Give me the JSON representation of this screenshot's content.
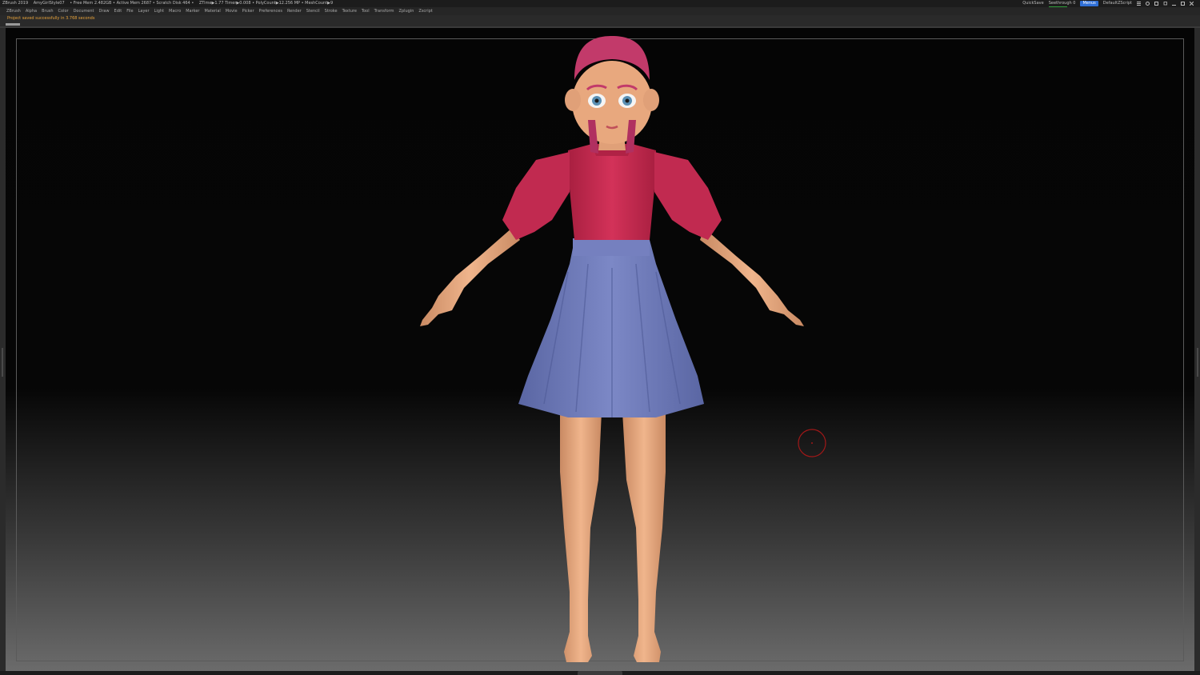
{
  "titlebar": {
    "items": [
      "ZBrush 2019",
      "AmyGirlStyle07",
      "• Free Mem 2.482GB • Active Mem 2687 • Scratch Disk 464 •",
      "ZTime▶1.77 Timer▶0.008 • PolyCount▶12.256 MP • MeshCount▶9"
    ],
    "right": {
      "quicksave": "QuickSave",
      "see_through": "Seethrough 0",
      "menus": "Menus",
      "script": "DefaultZScript"
    },
    "window_icons": [
      "list-icon",
      "gear-icon",
      "layout-icon",
      "restore-icon",
      "minimize-icon",
      "maximize-icon",
      "close-icon"
    ]
  },
  "menubar": {
    "items": [
      "ZBrush",
      "Alpha",
      "Brush",
      "Color",
      "Document",
      "Draw",
      "Edit",
      "File",
      "Layer",
      "Light",
      "Macro",
      "Marker",
      "Material",
      "Movie",
      "Picker",
      "Preferences",
      "Render",
      "Stencil",
      "Stroke",
      "Texture",
      "Tool",
      "Transform",
      "Zplugin",
      "Zscript"
    ]
  },
  "status": {
    "notice": "Project saved successfully in 3.768 seconds",
    "progress_fraction": 1.0
  },
  "viewport": {
    "model": "stylized girl character in A-pose",
    "colors": {
      "skin": "#e8a87e",
      "hair": "#c23a6a",
      "top": "#c8294e",
      "skirt": "#6f7bb8",
      "cursor_ring": "#a01818"
    }
  }
}
